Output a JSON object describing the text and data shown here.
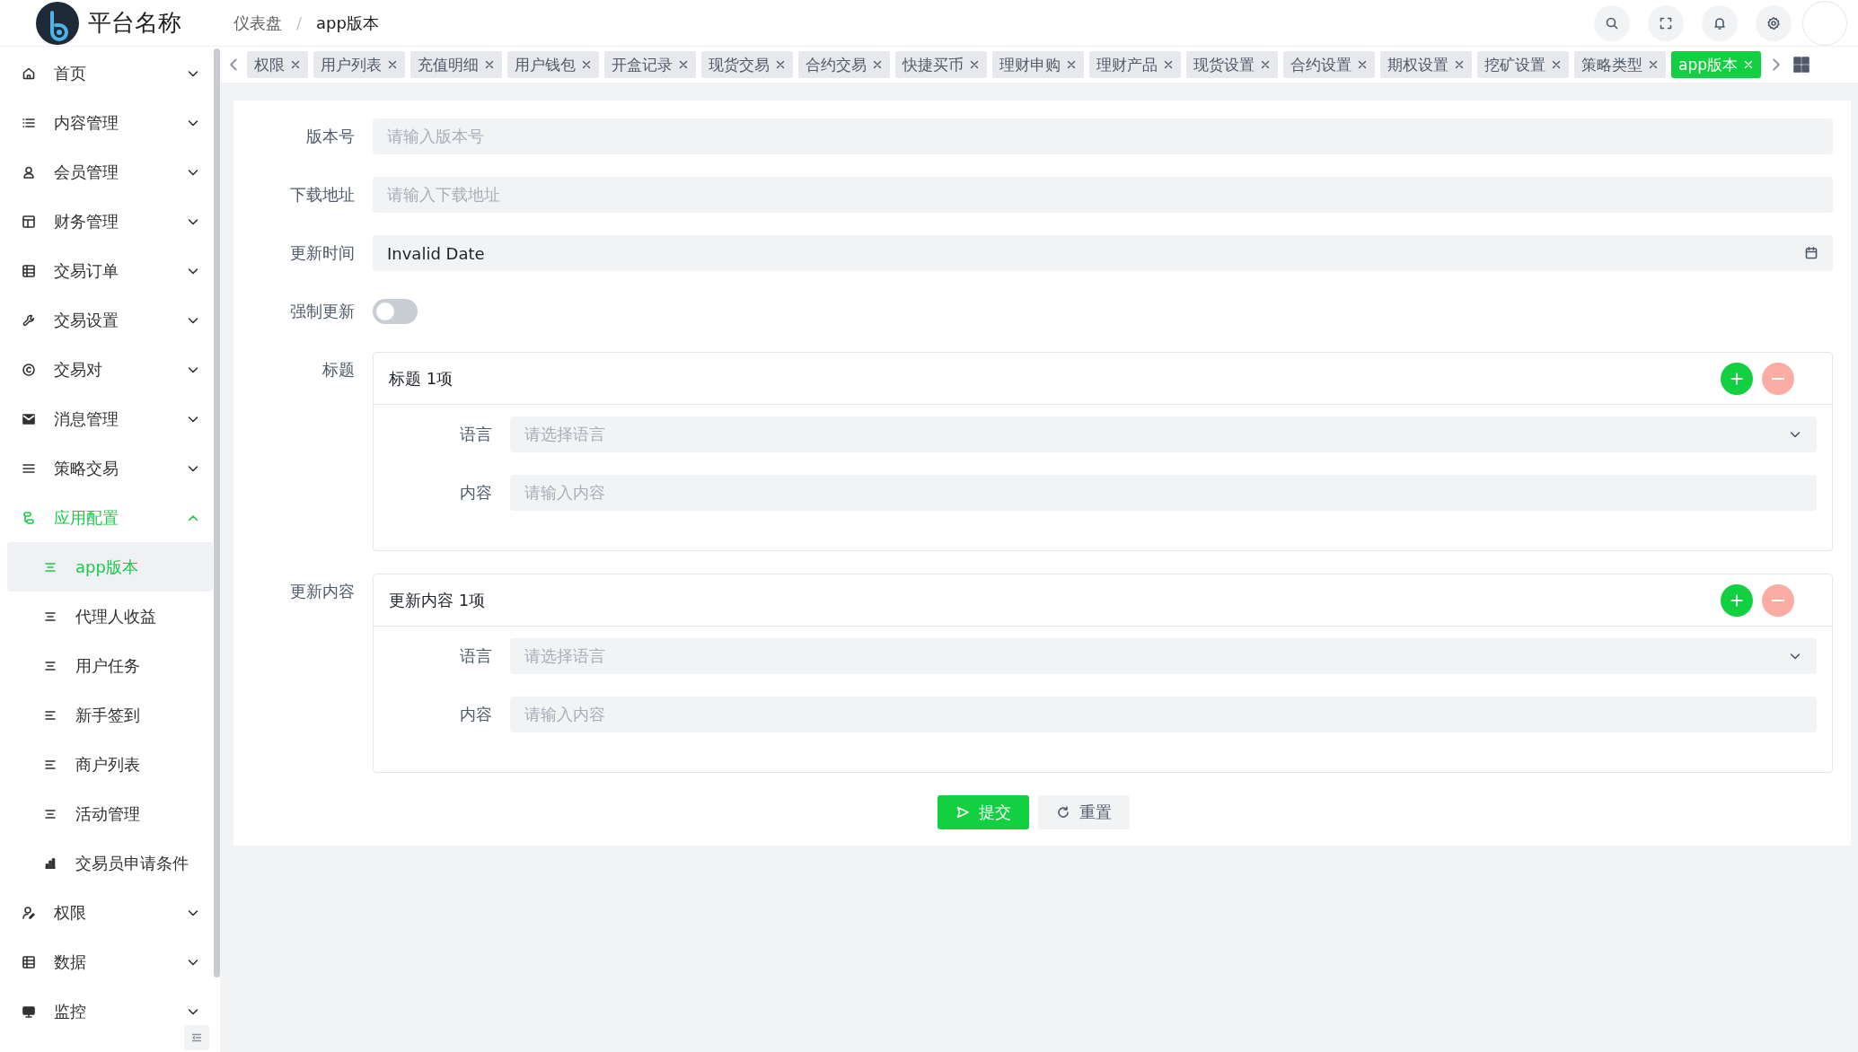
{
  "header": {
    "brand": "平台名称",
    "separator": "/",
    "breadcrumb": [
      {
        "label": "仪表盘",
        "current": false
      },
      {
        "label": "app版本",
        "current": true
      }
    ]
  },
  "sidebar": {
    "items": [
      {
        "label": "首页",
        "expanded": false
      },
      {
        "label": "内容管理",
        "expanded": false
      },
      {
        "label": "会员管理",
        "expanded": false
      },
      {
        "label": "财务管理",
        "expanded": false
      },
      {
        "label": "交易订单",
        "expanded": false
      },
      {
        "label": "交易设置",
        "expanded": false
      },
      {
        "label": "交易对",
        "expanded": false
      },
      {
        "label": "消息管理",
        "expanded": false
      },
      {
        "label": "策略交易",
        "expanded": false
      },
      {
        "label": "应用配置",
        "expanded": true,
        "children": [
          {
            "label": "app版本",
            "selected": true
          },
          {
            "label": "代理人收益",
            "selected": false
          },
          {
            "label": "用户任务",
            "selected": false
          },
          {
            "label": "新手签到",
            "selected": false
          },
          {
            "label": "商户列表",
            "selected": false
          },
          {
            "label": "活动管理",
            "selected": false
          },
          {
            "label": "交易员申请条件",
            "selected": false
          }
        ]
      },
      {
        "label": "权限",
        "expanded": false
      },
      {
        "label": "数据",
        "expanded": false
      },
      {
        "label": "监控",
        "expanded": false
      }
    ]
  },
  "tabs": [
    {
      "label": "权限",
      "selected": false
    },
    {
      "label": "用户列表",
      "selected": false
    },
    {
      "label": "充值明细",
      "selected": false
    },
    {
      "label": "用户钱包",
      "selected": false
    },
    {
      "label": "开盒记录",
      "selected": false
    },
    {
      "label": "现货交易",
      "selected": false
    },
    {
      "label": "合约交易",
      "selected": false
    },
    {
      "label": "快捷买币",
      "selected": false
    },
    {
      "label": "理财申购",
      "selected": false
    },
    {
      "label": "理财产品",
      "selected": false
    },
    {
      "label": "现货设置",
      "selected": false
    },
    {
      "label": "合约设置",
      "selected": false
    },
    {
      "label": "期权设置",
      "selected": false
    },
    {
      "label": "挖矿设置",
      "selected": false
    },
    {
      "label": "策略类型",
      "selected": false
    },
    {
      "label": "app版本",
      "selected": true
    }
  ],
  "form": {
    "fields": [
      {
        "kind": "input",
        "label": "版本号",
        "placeholder": "请输入版本号"
      },
      {
        "kind": "input",
        "label": "下载地址",
        "placeholder": "请输入下载地址"
      },
      {
        "kind": "date",
        "label": "更新时间",
        "value": "Invalid Date"
      },
      {
        "kind": "switch",
        "label": "强制更新",
        "on": false
      },
      {
        "kind": "group",
        "label": "标题",
        "cards": [
          {
            "title": "标题 1项",
            "rows": [
              {
                "kind": "select",
                "label": "语言",
                "placeholder": "请选择语言"
              },
              {
                "kind": "input",
                "label": "内容",
                "placeholder": "请输入内容"
              }
            ]
          }
        ]
      },
      {
        "kind": "group",
        "label": "更新内容",
        "cards": [
          {
            "title": "更新内容 1项",
            "rows": [
              {
                "kind": "select",
                "label": "语言",
                "placeholder": "请选择语言"
              },
              {
                "kind": "input",
                "label": "内容",
                "placeholder": "请输入内容"
              }
            ]
          }
        ]
      }
    ],
    "buttons": [
      {
        "kind": "primary",
        "label": "提交"
      },
      {
        "kind": "default",
        "label": "重置"
      }
    ]
  }
}
